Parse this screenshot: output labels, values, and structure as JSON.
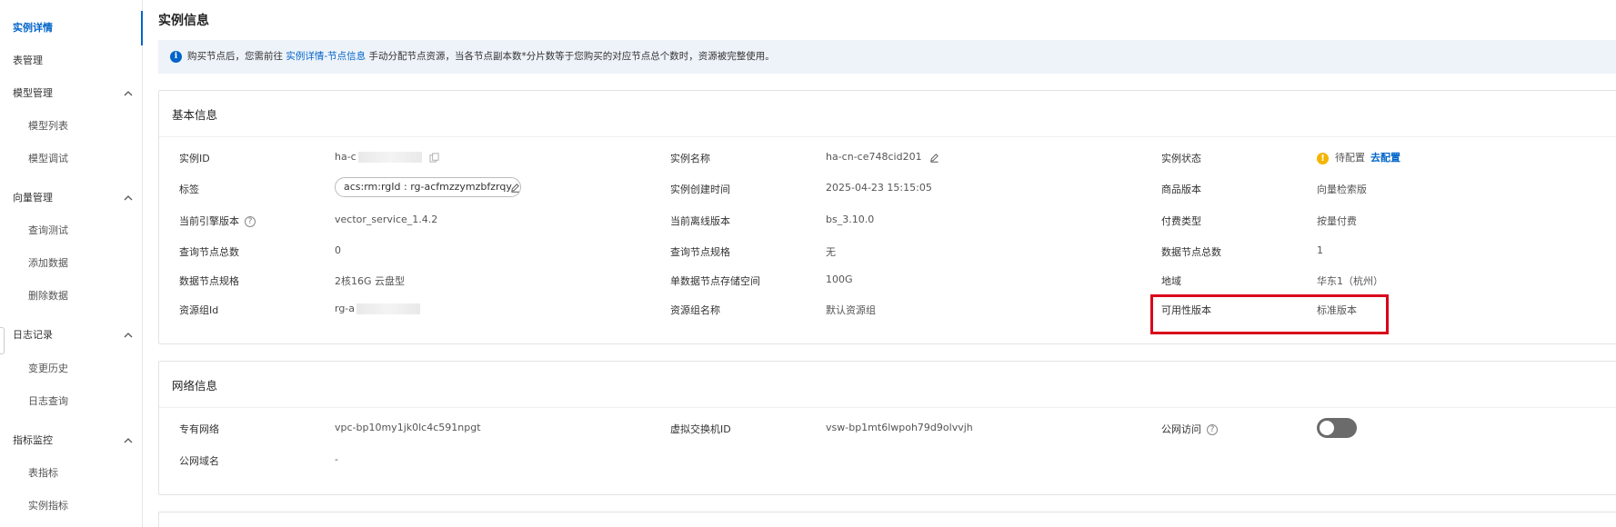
{
  "sidebar": {
    "items": [
      {
        "label": "实例详情"
      },
      {
        "label": "表管理"
      },
      {
        "label": "模型管理"
      },
      {
        "label": "模型列表"
      },
      {
        "label": "模型调试"
      },
      {
        "label": "向量管理"
      },
      {
        "label": "查询测试"
      },
      {
        "label": "添加数据"
      },
      {
        "label": "删除数据"
      },
      {
        "label": "日志记录"
      },
      {
        "label": "变更历史"
      },
      {
        "label": "日志查询"
      },
      {
        "label": "指标监控"
      },
      {
        "label": "表指标"
      },
      {
        "label": "实例指标"
      }
    ]
  },
  "page": {
    "title": "实例信息"
  },
  "notice": {
    "text_before": "购买节点后，您需前往",
    "link": "实例详情-节点信息",
    "text_after": "手动分配节点资源，当各节点副本数*分片数等于您购买的对应节点总个数时，资源被完整使用。"
  },
  "basic": {
    "title": "基本信息",
    "instance_id_label": "实例ID",
    "instance_id_value": "ha-c",
    "instance_name_label": "实例名称",
    "instance_name_value": "ha-cn-ce748cid201",
    "instance_status_label": "实例状态",
    "instance_status_value": "待配置",
    "instance_status_link": "去配置",
    "tag_label": "标签",
    "tag_value": "acs:rm:rgId : rg-acfmzzymzbfzrqy",
    "created_label": "实例创建时间",
    "created_value": "2025-04-23 15:15:05",
    "product_version_label": "商品版本",
    "product_version_value": "向量检索版",
    "engine_version_label": "当前引擎版本",
    "engine_version_value": "vector_service_1.4.2",
    "offline_version_label": "当前离线版本",
    "offline_version_value": "bs_3.10.0",
    "billing_label": "付费类型",
    "billing_value": "按量付费",
    "query_nodes_label": "查询节点总数",
    "query_nodes_value": "0",
    "query_spec_label": "查询节点规格",
    "query_spec_value": "无",
    "data_nodes_label": "数据节点总数",
    "data_nodes_value": "1",
    "data_spec_label": "数据节点规格",
    "data_spec_value": "2核16G 云盘型",
    "storage_label": "单数据节点存储空间",
    "storage_value": "100G",
    "region_label": "地域",
    "region_value": "华东1（杭州）",
    "rg_id_label": "资源组Id",
    "rg_id_value": "rg-a",
    "rg_name_label": "资源组名称",
    "rg_name_value": "默认资源组",
    "availability_label": "可用性版本",
    "availability_value": "标准版本"
  },
  "network": {
    "title": "网络信息",
    "vpc_label": "专有网络",
    "vpc_value": "vpc-bp10my1jk0lc4c591npgt",
    "vswitch_label": "虚拟交换机ID",
    "vswitch_value": "vsw-bp1mt6lwpoh79d9olvvjh",
    "public_access_label": "公网访问",
    "public_domain_label": "公网域名",
    "public_domain_value": "-"
  },
  "colors": {
    "accent": "#0064c8",
    "warning": "#f5b400",
    "highlight": "#d9001b"
  }
}
